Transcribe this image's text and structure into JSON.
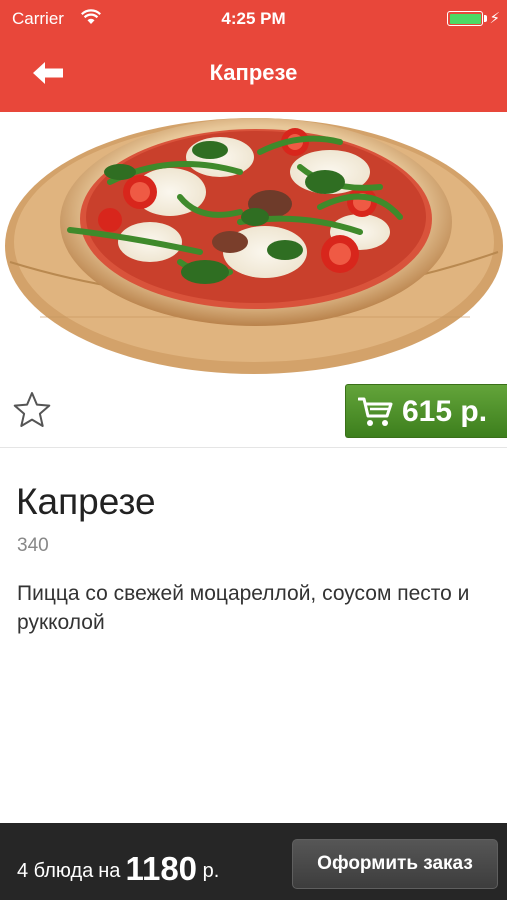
{
  "status_bar": {
    "carrier": "Carrier",
    "time": "4:25 PM"
  },
  "nav": {
    "title": "Капрезе",
    "back_icon": "arrow-left-icon"
  },
  "product": {
    "name": "Капрезе",
    "weight": "340",
    "description": "Пицца со свежей моцареллой, соусом песто и рукколой",
    "price": "615 р.",
    "image": "pizza-caprese-photo",
    "favorite_icon": "star-outline-icon",
    "cart_icon": "cart-icon"
  },
  "order_summary": {
    "count_label": "4 блюда",
    "connector": "на",
    "total": "1180",
    "currency": "р.",
    "checkout_label": "Оформить заказ"
  },
  "colors": {
    "header": "#e8473a",
    "price_button": "#4e9128",
    "bottom_bar": "#262626",
    "battery": "#4cd964"
  }
}
